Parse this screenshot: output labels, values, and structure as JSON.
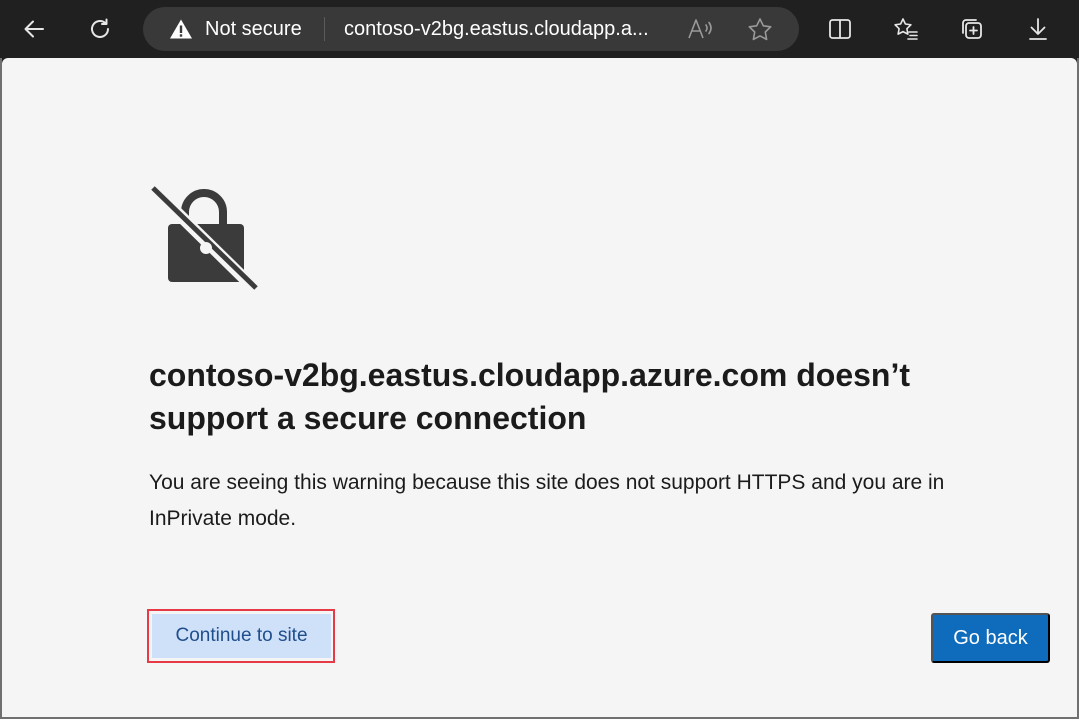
{
  "browser": {
    "address_bar": {
      "security_status": "Not secure",
      "url": "contoso-v2bg.eastus.cloudapp.a..."
    },
    "icons": {
      "back": "back-arrow-icon",
      "refresh": "refresh-icon",
      "warning": "warning-triangle-icon",
      "read_aloud": "read-aloud-icon",
      "favorite": "star-icon",
      "split_screen": "split-screen-icon",
      "favorites": "favorites-icon",
      "collections": "collections-icon",
      "downloads": "download-icon"
    }
  },
  "page": {
    "icon": "unlocked-padlock-icon",
    "headline": "contoso-v2bg.eastus.cloudapp.azure.com doesn’t support a secure connection",
    "description": "You are seeing this warning because this site does not support HTTPS and you are in InPrivate mode.",
    "continue_label": "Continue to site",
    "go_back_label": "Go back"
  },
  "colors": {
    "toolbar_bg": "#202020",
    "content_bg": "#f5f5f5",
    "primary_button": "#0f6cbd",
    "secondary_button": "#cfe1f9",
    "highlight_border": "#e63a47"
  }
}
